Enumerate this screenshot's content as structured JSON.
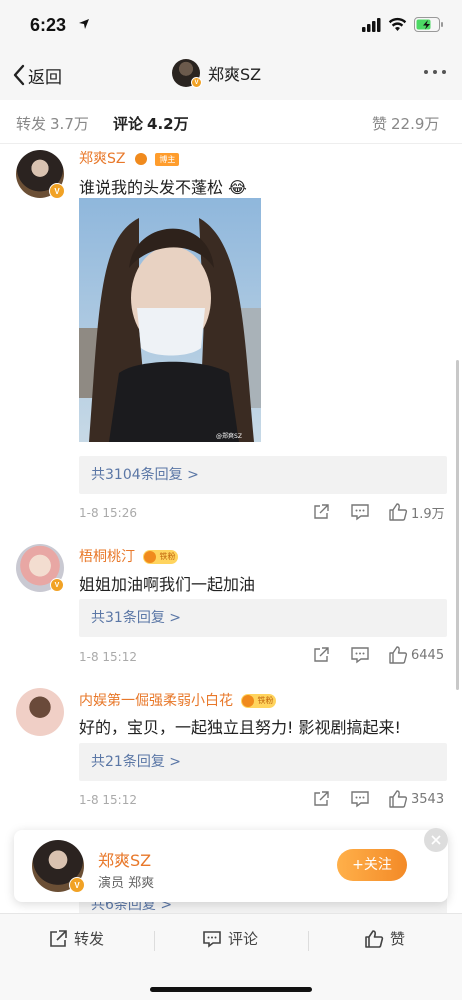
{
  "status": {
    "time": "6:23"
  },
  "nav": {
    "back_label": "返回",
    "title": "郑爽SZ"
  },
  "tabs": {
    "repost": {
      "label": "转发",
      "count": "3.7万"
    },
    "comment": {
      "label": "评论",
      "count": "4.2万"
    },
    "like": {
      "label": "赞",
      "count": "22.9万"
    }
  },
  "comments": [
    {
      "username": "郑爽SZ",
      "badge": "博主",
      "text": "谁说我的头发不蓬松",
      "emoji": "😂",
      "replies": "共3104条回复 >",
      "date": "1-8 15:26",
      "likes": "1.9万",
      "photo_watermark": "@郑爽SZ"
    },
    {
      "username": "梧桐桃汀",
      "fan_badge": "铁粉",
      "text": "姐姐加油啊我们一起加油",
      "replies": "共31条回复 >",
      "date": "1-8 15:12",
      "likes": "6445"
    },
    {
      "username": "内娱第一倔强柔弱小白花",
      "fan_badge": "铁粉",
      "text": "好的，宝贝，一起独立且努力! 影视剧搞起来!",
      "replies": "共21条回复 >",
      "date": "1-8 15:12",
      "likes": "3543"
    },
    {
      "replies": "共6条回复 >"
    }
  ],
  "float_card": {
    "name": "郑爽SZ",
    "desc": "演员 郑爽",
    "follow_label": "+关注"
  },
  "bottom_bar": {
    "repost": "转发",
    "comment": "评论",
    "like": "赞"
  },
  "colors": {
    "username": "#e8782a",
    "reply_link": "#5b77a6",
    "follow": "#f38a27",
    "verified": "#f1a225"
  }
}
